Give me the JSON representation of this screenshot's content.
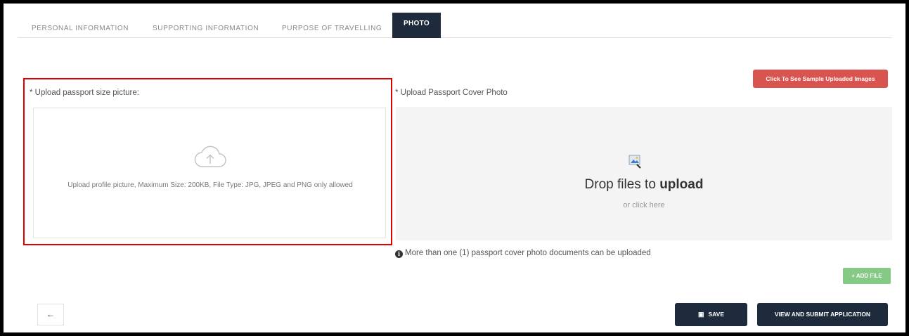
{
  "tabs": [
    {
      "label": "PERSONAL INFORMATION"
    },
    {
      "label": "SUPPORTING INFORMATION"
    },
    {
      "label": "PURPOSE OF TRAVELLING"
    },
    {
      "label": "PHOTO",
      "active": true
    }
  ],
  "sample_button": {
    "label": "Click To See Sample Uploaded Images"
  },
  "profile_upload": {
    "label": "* Upload passport size picture:",
    "hint": "Upload profile picture, Maximum Size: 200KB, File Type: JPG, JPEG and PNG only allowed",
    "icon": "cloud-upload-icon"
  },
  "cover_upload": {
    "label": "* Upload Passport Cover Photo",
    "drop_prefix": "Drop files to ",
    "drop_bold": "upload",
    "drop_sub": "or click here",
    "icon": "image-icon"
  },
  "info_text": "More than one (1) passport cover photo documents can be uploaded",
  "add_file": {
    "label": "+ ADD FILE"
  },
  "back": {
    "icon": "arrow-left-icon",
    "glyph": "←"
  },
  "save": {
    "label": "SAVE",
    "icon": "floppy-disk-icon"
  },
  "submit": {
    "label": "VIEW AND SUBMIT APPLICATION"
  },
  "colors": {
    "dark_navy": "#1e2b3c",
    "danger": "#d9534f",
    "success": "#5cb85c",
    "highlight_red": "#e00000"
  }
}
